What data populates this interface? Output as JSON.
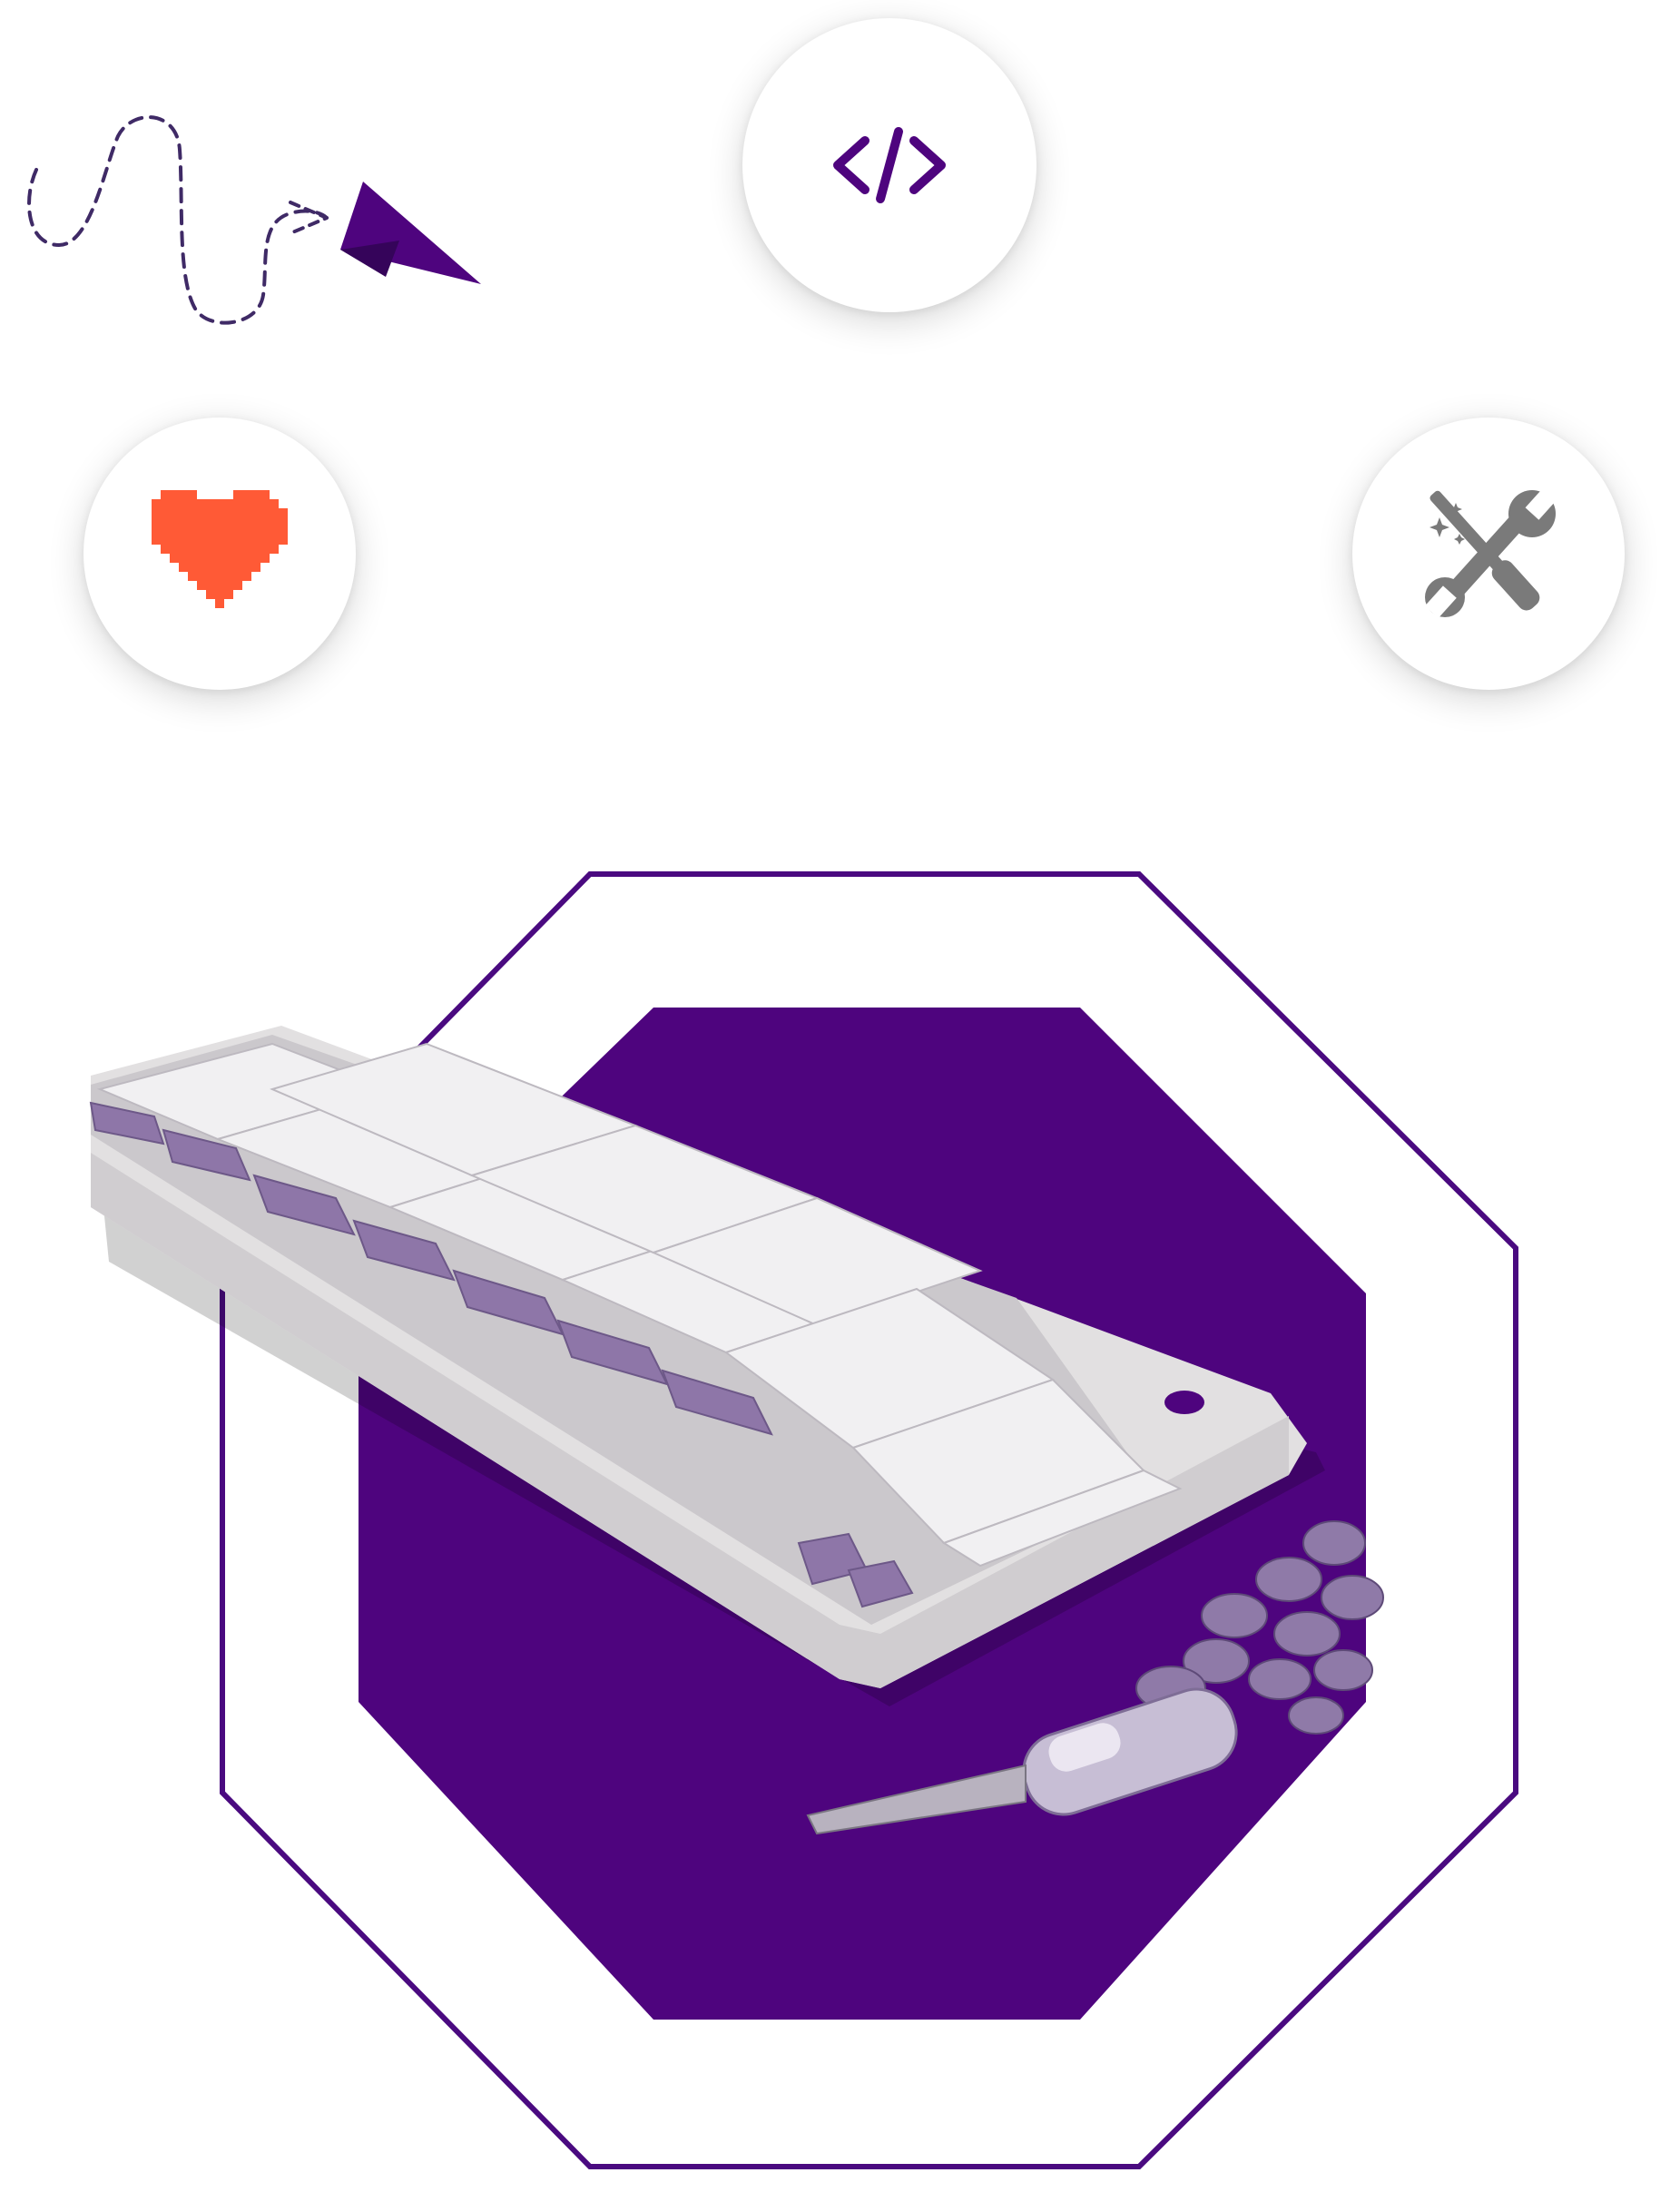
{
  "page": {
    "background": "#ffffff"
  },
  "colors": {
    "accent_purple": "#4e047e",
    "frame_purple": "#4a0a80",
    "heart_orange": "#ff5a36",
    "tools_gray": "#7a7a7a",
    "dash_purple": "#3f2a66"
  },
  "icons": {
    "code": "code-brackets-icon",
    "heart": "pixel-heart-icon",
    "tools": "wrench-screwdriver-icon",
    "doodle": "dashed-path-paper-plane-icon"
  },
  "hero": {
    "image": "keyboard-photo",
    "frame": "octagon-frame"
  }
}
